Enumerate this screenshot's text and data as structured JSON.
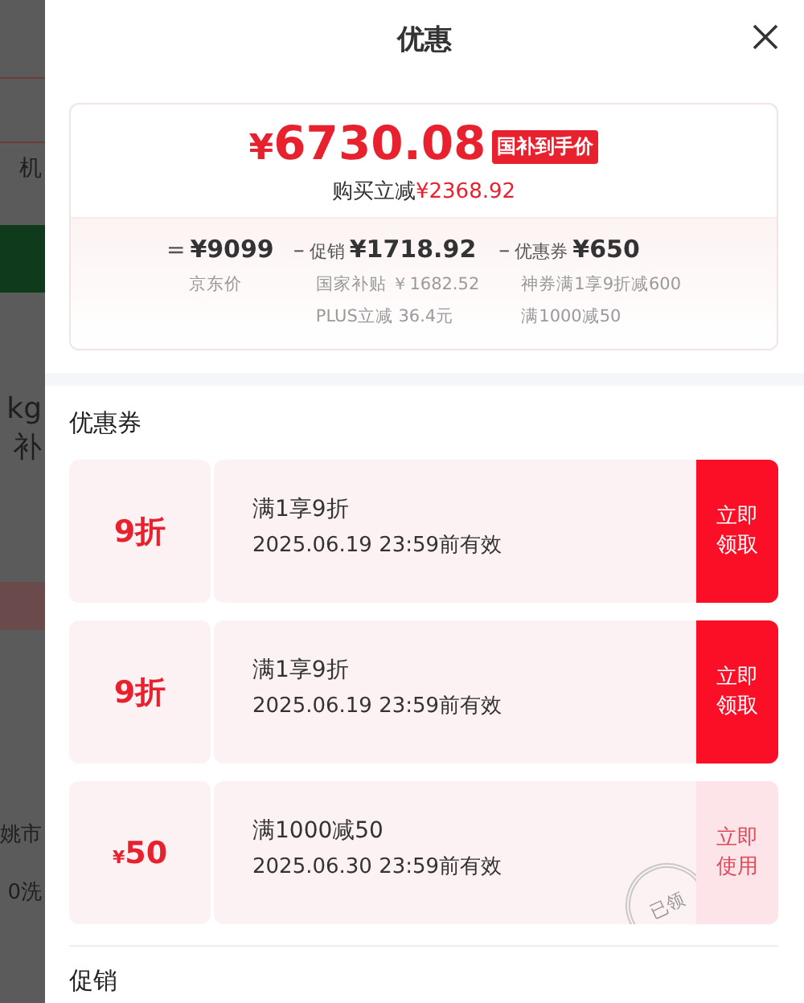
{
  "backdrop": {
    "texts": [
      "机",
      "kg",
      "补",
      "姚市",
      "0洗"
    ]
  },
  "sheet": {
    "title": "优惠"
  },
  "price_card": {
    "currency": "¥",
    "amount": "6730.08",
    "tag": "国补到手价",
    "saving_label": "购买立减",
    "saving": "¥2368.92",
    "breakdown": [
      {
        "operator": "=",
        "value": "¥9099",
        "details": [
          "京东价"
        ]
      },
      {
        "operator": "–",
        "label": "促销",
        "value": "¥1718.92",
        "details": [
          "国家补贴 ￥1682.52",
          "PLUS立减 36.4元"
        ]
      },
      {
        "operator": "–",
        "label": "优惠券",
        "value": "¥650",
        "details": [
          "神券满1享9折减600",
          "满1000减50"
        ]
      }
    ]
  },
  "coupons_section": {
    "heading": "优惠券",
    "coupons": [
      {
        "value": "9折",
        "condition": "满1享9折",
        "validity": "2025.06.19 23:59前有效",
        "action": "立即领取",
        "claimed": false
      },
      {
        "value": "9折",
        "condition": "满1享9折",
        "validity": "2025.06.19 23:59前有效",
        "action": "立即领取",
        "claimed": false
      },
      {
        "currency": "¥",
        "value": "50",
        "condition": "满1000减50",
        "validity": "2025.06.30 23:59前有效",
        "action": "立即使用",
        "claimed": true,
        "stamp": "已领"
      }
    ]
  },
  "promotions_section": {
    "heading": "促销"
  }
}
